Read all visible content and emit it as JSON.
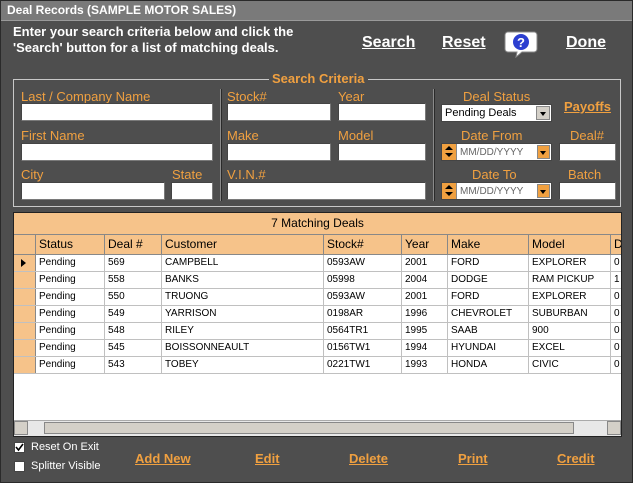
{
  "window": {
    "title": "Deal Records  (SAMPLE MOTOR SALES)"
  },
  "instructions": "Enter your search criteria below and click the 'Search' button for a list of matching deals.",
  "toolbar": {
    "search": "Search",
    "reset": "Reset",
    "done": "Done"
  },
  "criteria": {
    "title": "Search Criteria",
    "last_name": "Last / Company Name",
    "first_name": "First Name",
    "city": "City",
    "state": "State",
    "stock": "Stock#",
    "year": "Year",
    "make": "Make",
    "model": "Model",
    "vin": "V.I.N.#",
    "deal_status": "Deal Status",
    "deal_status_value": "Pending Deals",
    "payoffs": "Payoffs",
    "date_from": "Date From",
    "date_to": "Date To",
    "date_placeholder": "MM/DD/YYYY",
    "deal_no": "Deal#",
    "batch": "Batch"
  },
  "grid": {
    "caption": "7 Matching Deals",
    "columns": [
      "Status",
      "Deal #",
      "Customer",
      "Stock#",
      "Year",
      "Make",
      "Model",
      "D"
    ],
    "rows": [
      [
        "Pending",
        "569",
        "CAMPBELL",
        "0593AW",
        "2001",
        "FORD",
        "EXPLORER",
        "0"
      ],
      [
        "Pending",
        "558",
        "BANKS",
        "05998",
        "2004",
        "DODGE",
        "RAM PICKUP",
        "1"
      ],
      [
        "Pending",
        "550",
        "TRUONG",
        "0593AW",
        "2001",
        "FORD",
        "EXPLORER",
        "0"
      ],
      [
        "Pending",
        "549",
        "YARRISON",
        "0198AR",
        "1996",
        "CHEVROLET",
        "SUBURBAN",
        "0"
      ],
      [
        "Pending",
        "548",
        "RILEY",
        "0564TR1",
        "1995",
        "SAAB",
        "900",
        "0"
      ],
      [
        "Pending",
        "545",
        "BOISSONNEAULT",
        "0156TW1",
        "1994",
        "HYUNDAI",
        "EXCEL",
        "0"
      ],
      [
        "Pending",
        "543",
        "TOBEY",
        "0221TW1",
        "1993",
        "HONDA",
        "CIVIC",
        "0"
      ]
    ]
  },
  "options": {
    "reset_on_exit": "Reset On Exit",
    "splitter_visible": "Splitter Visible"
  },
  "actions": {
    "add_new": "Add New",
    "edit": "Edit",
    "delete": "Delete",
    "print": "Print",
    "credit": "Credit"
  },
  "colors": {
    "accent": "#f0a040",
    "background": "#4e4e4e",
    "grid_header": "#f6c38a"
  }
}
